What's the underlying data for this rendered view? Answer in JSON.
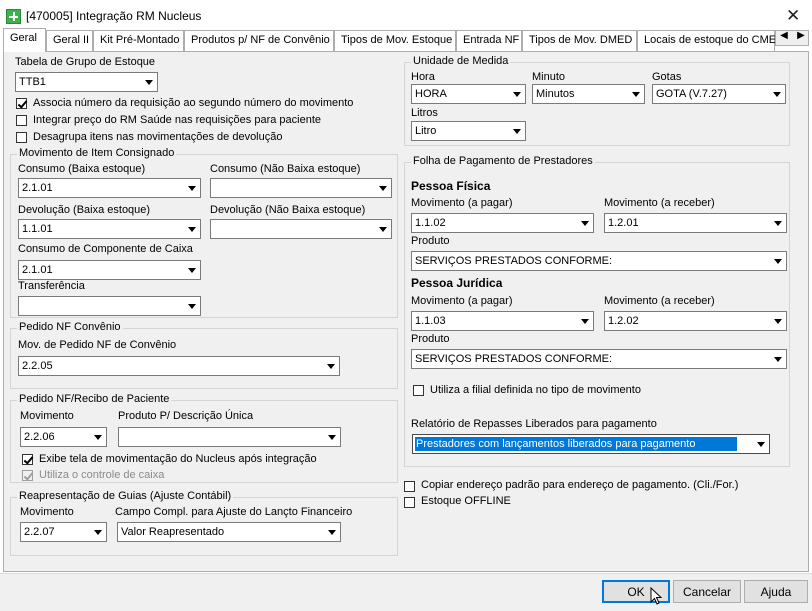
{
  "window": {
    "title": "[470005]  Integração RM Nucleus"
  },
  "tabs": [
    {
      "label": "Geral"
    },
    {
      "label": "Geral II"
    },
    {
      "label": "Kit Pré-Montado"
    },
    {
      "label": "Produtos p/ NF de Convênio"
    },
    {
      "label": "Tipos de Mov. Estoque"
    },
    {
      "label": "Entrada NF"
    },
    {
      "label": "Tipos de Mov. DMED"
    },
    {
      "label": "Locais de estoque do CME"
    }
  ],
  "left": {
    "tabela_label": "Tabela de Grupo de Estoque",
    "tabela_value": "TTB1",
    "chk1": "Associa número da requisição ao segundo número do movimento",
    "chk2": "Integrar preço do RM Saúde nas requisições para paciente",
    "chk3": "Desagrupa itens nas movimentações de  devolução",
    "consignado": {
      "title": "Movimento de Item Consignado",
      "consumo_baixa_label": "Consumo (Baixa estoque)",
      "consumo_baixa_value": "2.1.01",
      "consumo_nao_label": "Consumo (Não Baixa estoque)",
      "consumo_nao_value": "",
      "devol_baixa_label": "Devolução (Baixa estoque)",
      "devol_baixa_value": "1.1.01",
      "devol_nao_label": "Devolução (Não Baixa estoque)",
      "devol_nao_value": "",
      "caixa_label": "Consumo de Componente de Caixa",
      "caixa_value": "2.1.01",
      "transf_label": "Transferência",
      "transf_value": ""
    },
    "pedido_nf": {
      "title": "Pedido NF Convênio",
      "mov_label": "Mov. de Pedido NF de Convênio",
      "mov_value": "2.2.05"
    },
    "pedido_paciente": {
      "title": "Pedido NF/Recibo de Paciente",
      "mov_label": "Movimento",
      "mov_value": "2.2.06",
      "prod_label": "Produto P/ Descrição Única",
      "prod_value": "",
      "chk_exibe": "Exibe tela de movimentação do Nucleus após integração",
      "chk_controle": "Utiliza o controle de caixa"
    },
    "reapresentacao": {
      "title": "Reapresentação de Guias (Ajuste Contábil)",
      "mov_label": "Movimento",
      "mov_value": "2.2.07",
      "campo_label": "Campo Compl. para Ajuste do Lançto Financeiro",
      "campo_value": "Valor Reapresentado"
    }
  },
  "right": {
    "unidade": {
      "title": "Unidade de Medida",
      "hora_label": "Hora",
      "hora_value": "HORA",
      "minuto_label": "Minuto",
      "minuto_value": "Minutos",
      "gotas_label": "Gotas",
      "gotas_value": "GOTA (V.7.27)",
      "litros_label": "Litros",
      "litros_value": "Litro"
    },
    "folha": {
      "title": "Folha de Pagamento de Prestadores",
      "pf_title": "Pessoa Física",
      "pf_mov_pagar_label": "Movimento (a pagar)",
      "pf_mov_pagar_value": "1.1.02",
      "pf_mov_receber_label": "Movimento (a receber)",
      "pf_mov_receber_value": "1.2.01",
      "pf_prod_label": "Produto",
      "pf_prod_value": "SERVIÇOS PRESTADOS CONFORME:",
      "pj_title": "Pessoa Jurídica",
      "pj_mov_pagar_label": "Movimento (a pagar)",
      "pj_mov_pagar_value": "1.1.03",
      "pj_mov_receber_label": "Movimento (a receber)",
      "pj_mov_receber_value": "1.2.02",
      "pj_prod_label": "Produto",
      "pj_prod_value": "SERVIÇOS PRESTADOS CONFORME:",
      "chk_filial": "Utiliza a filial definida no tipo de movimento",
      "relatorio_label": "Relatório de Repasses Liberados para pagamento",
      "relatorio_value": "Prestadores com lançamentos liberados para pagamento"
    },
    "chk_copiar": "Copiar endereço padrão para endereço de pagamento. (Cli./For.)",
    "chk_offline": "Estoque OFFLINE"
  },
  "buttons": {
    "ok": "OK",
    "cancel": "Cancelar",
    "help": "Ajuda"
  }
}
